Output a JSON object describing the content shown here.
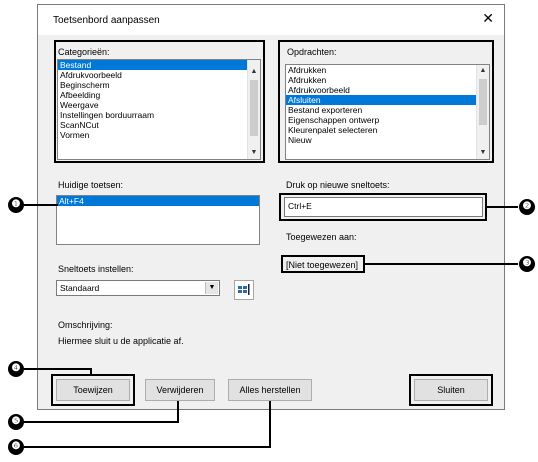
{
  "dialog": {
    "title": "Toetsenbord aanpassen",
    "close_glyph": "✕"
  },
  "categories": {
    "label": "Categorieën:",
    "items": [
      "Bestand",
      "Afdrukvoorbeeld",
      "Beginscherm",
      "Afbeelding",
      "Weergave",
      "Instellingen borduurraam",
      "ScanNCut",
      "Vormen"
    ],
    "selected_index": 0
  },
  "commands": {
    "label": "Opdrachten:",
    "items": [
      "Afdrukken",
      "Afdrukken",
      "Afdrukvoorbeeld",
      "Afsluiten",
      "Bestand exporteren",
      "Eigenschappen ontwerp",
      "Kleurenpalet selecteren",
      "Nieuw"
    ],
    "selected_index": 3
  },
  "current_keys": {
    "label": "Huidige toetsen:",
    "items": [
      "Alt+F4"
    ],
    "selected_index": 0
  },
  "new_shortcut": {
    "label": "Druk op nieuwe sneltoets:",
    "value": "Ctrl+E"
  },
  "assigned_to": {
    "label": "Toegewezen aan:",
    "value": "[Niet toegewezen]"
  },
  "shortcut_set": {
    "label": "Sneltoets instellen:",
    "value": "Standaard"
  },
  "description": {
    "label": "Omschrijving:",
    "text": "Hiermee sluit u de applicatie af."
  },
  "buttons": {
    "assign": "Toewijzen",
    "remove": "Verwijderen",
    "reset_all": "Alles herstellen",
    "close": "Sluiten"
  },
  "callouts": [
    "❶",
    "❷",
    "❸",
    "❹",
    "❺",
    "❻"
  ],
  "colors": {
    "selection": "#0078d7",
    "dialog_bg": "#f0f0f0",
    "highlight_border": "#000000"
  }
}
